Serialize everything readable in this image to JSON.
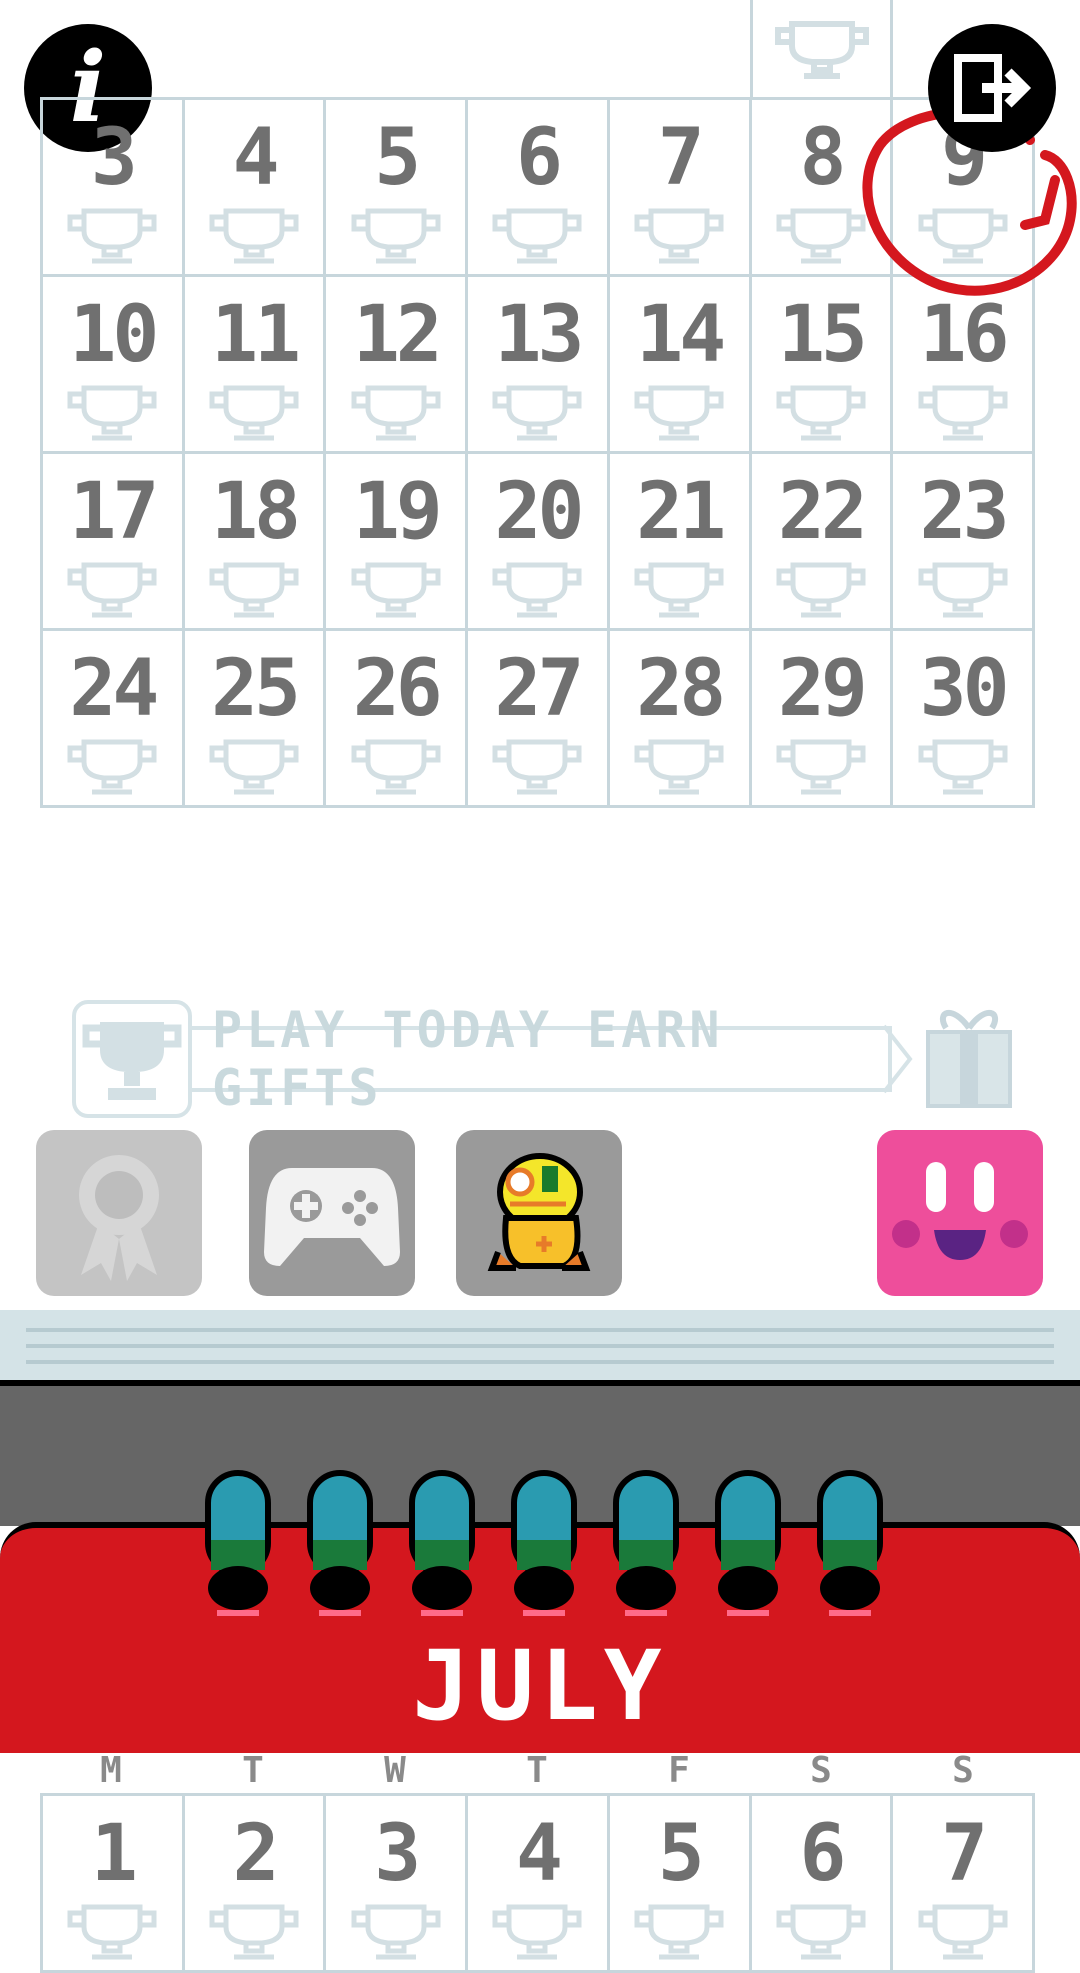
{
  "weeks_top": [
    [
      "3",
      "4",
      "5",
      "6",
      "7",
      "8",
      "9"
    ],
    [
      "10",
      "11",
      "12",
      "13",
      "14",
      "15",
      "16"
    ],
    [
      "17",
      "18",
      "19",
      "20",
      "21",
      "22",
      "23"
    ],
    [
      "24",
      "25",
      "26",
      "27",
      "28",
      "29",
      "30"
    ]
  ],
  "banner": {
    "text": "PLAY TODAY EARN GIFTS"
  },
  "tiles": [
    {
      "name": "achievements",
      "icon": "ribbon-badge-icon",
      "color": "#c4c4c4"
    },
    {
      "name": "game-services",
      "icon": "gamepad-icon",
      "color": "#9a9a9a"
    },
    {
      "name": "character",
      "icon": "yellow-frog-character-icon",
      "color": "#9a9a9a"
    },
    {
      "name": "pink-friend",
      "icon": "pink-square-face-icon",
      "color": "#ee4e9b"
    }
  ],
  "month": "JULY",
  "weekday_labels": [
    "M",
    "T",
    "W",
    "T",
    "F",
    "S",
    "S"
  ],
  "week_bottom": [
    "1",
    "2",
    "3",
    "4",
    "5",
    "6",
    "7"
  ],
  "colors": {
    "red": "#d4171e",
    "grid": "#c7d6dc",
    "number": "#707070",
    "ring": "#2a9bb0"
  }
}
